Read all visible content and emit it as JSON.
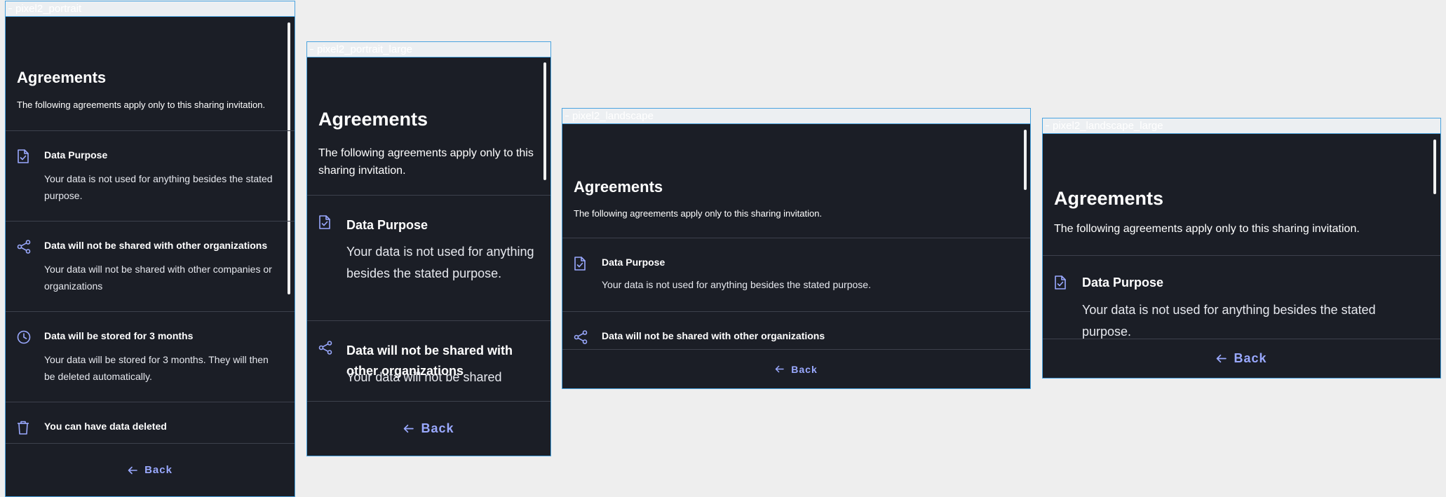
{
  "colors": {
    "background": "#eeeeee",
    "screen": "#1b1e26",
    "divider": "#3d414c",
    "accent": "#9aa9ff",
    "frame_border": "#4aa3df"
  },
  "frames": [
    {
      "label": "pixel2_portrait",
      "title": "Agreements",
      "subtitle": "The following agreements apply only to this sharing invitation.",
      "items": [
        {
          "icon": "document-check-icon",
          "title": "Data Purpose",
          "description": "Your data is not used for anything besides the stated purpose."
        },
        {
          "icon": "share-icon",
          "title": "Data will not be shared with other organizations",
          "description": "Your data will not be shared with other companies or organizations"
        },
        {
          "icon": "clock-icon",
          "title": "Data will be stored for 3 months",
          "description": "Your data will be stored for 3 months. They will then be deleted automatically."
        },
        {
          "icon": "trash-icon",
          "title": "You can have data deleted",
          "description": ""
        }
      ],
      "back_label": "Back"
    },
    {
      "label": "pixel2_portrait_large",
      "title": "Agreements",
      "subtitle": "The following agreements apply only to this sharing invitation.",
      "items": [
        {
          "icon": "document-check-icon",
          "title": "Data Purpose",
          "description": "Your data is not used for anything besides the stated purpose."
        },
        {
          "icon": "share-icon",
          "title": "Data will not be shared with other organizations",
          "description": "Your data will not be shared"
        }
      ],
      "back_label": "Back"
    },
    {
      "label": "pixel2_landscape",
      "title": "Agreements",
      "subtitle": "The following agreements apply only to this sharing invitation.",
      "items": [
        {
          "icon": "document-check-icon",
          "title": "Data Purpose",
          "description": "Your data is not used for anything besides the stated purpose."
        },
        {
          "icon": "share-icon",
          "title": "Data will not be shared with other organizations",
          "description": ""
        }
      ],
      "back_label": "Back"
    },
    {
      "label": "pixel2_landscape_large",
      "title": "Agreements",
      "subtitle": "The following agreements apply only to this sharing invitation.",
      "items": [
        {
          "icon": "document-check-icon",
          "title": "Data Purpose",
          "description": "Your data is not used for anything besides the stated purpose."
        }
      ],
      "back_label": "Back"
    }
  ]
}
